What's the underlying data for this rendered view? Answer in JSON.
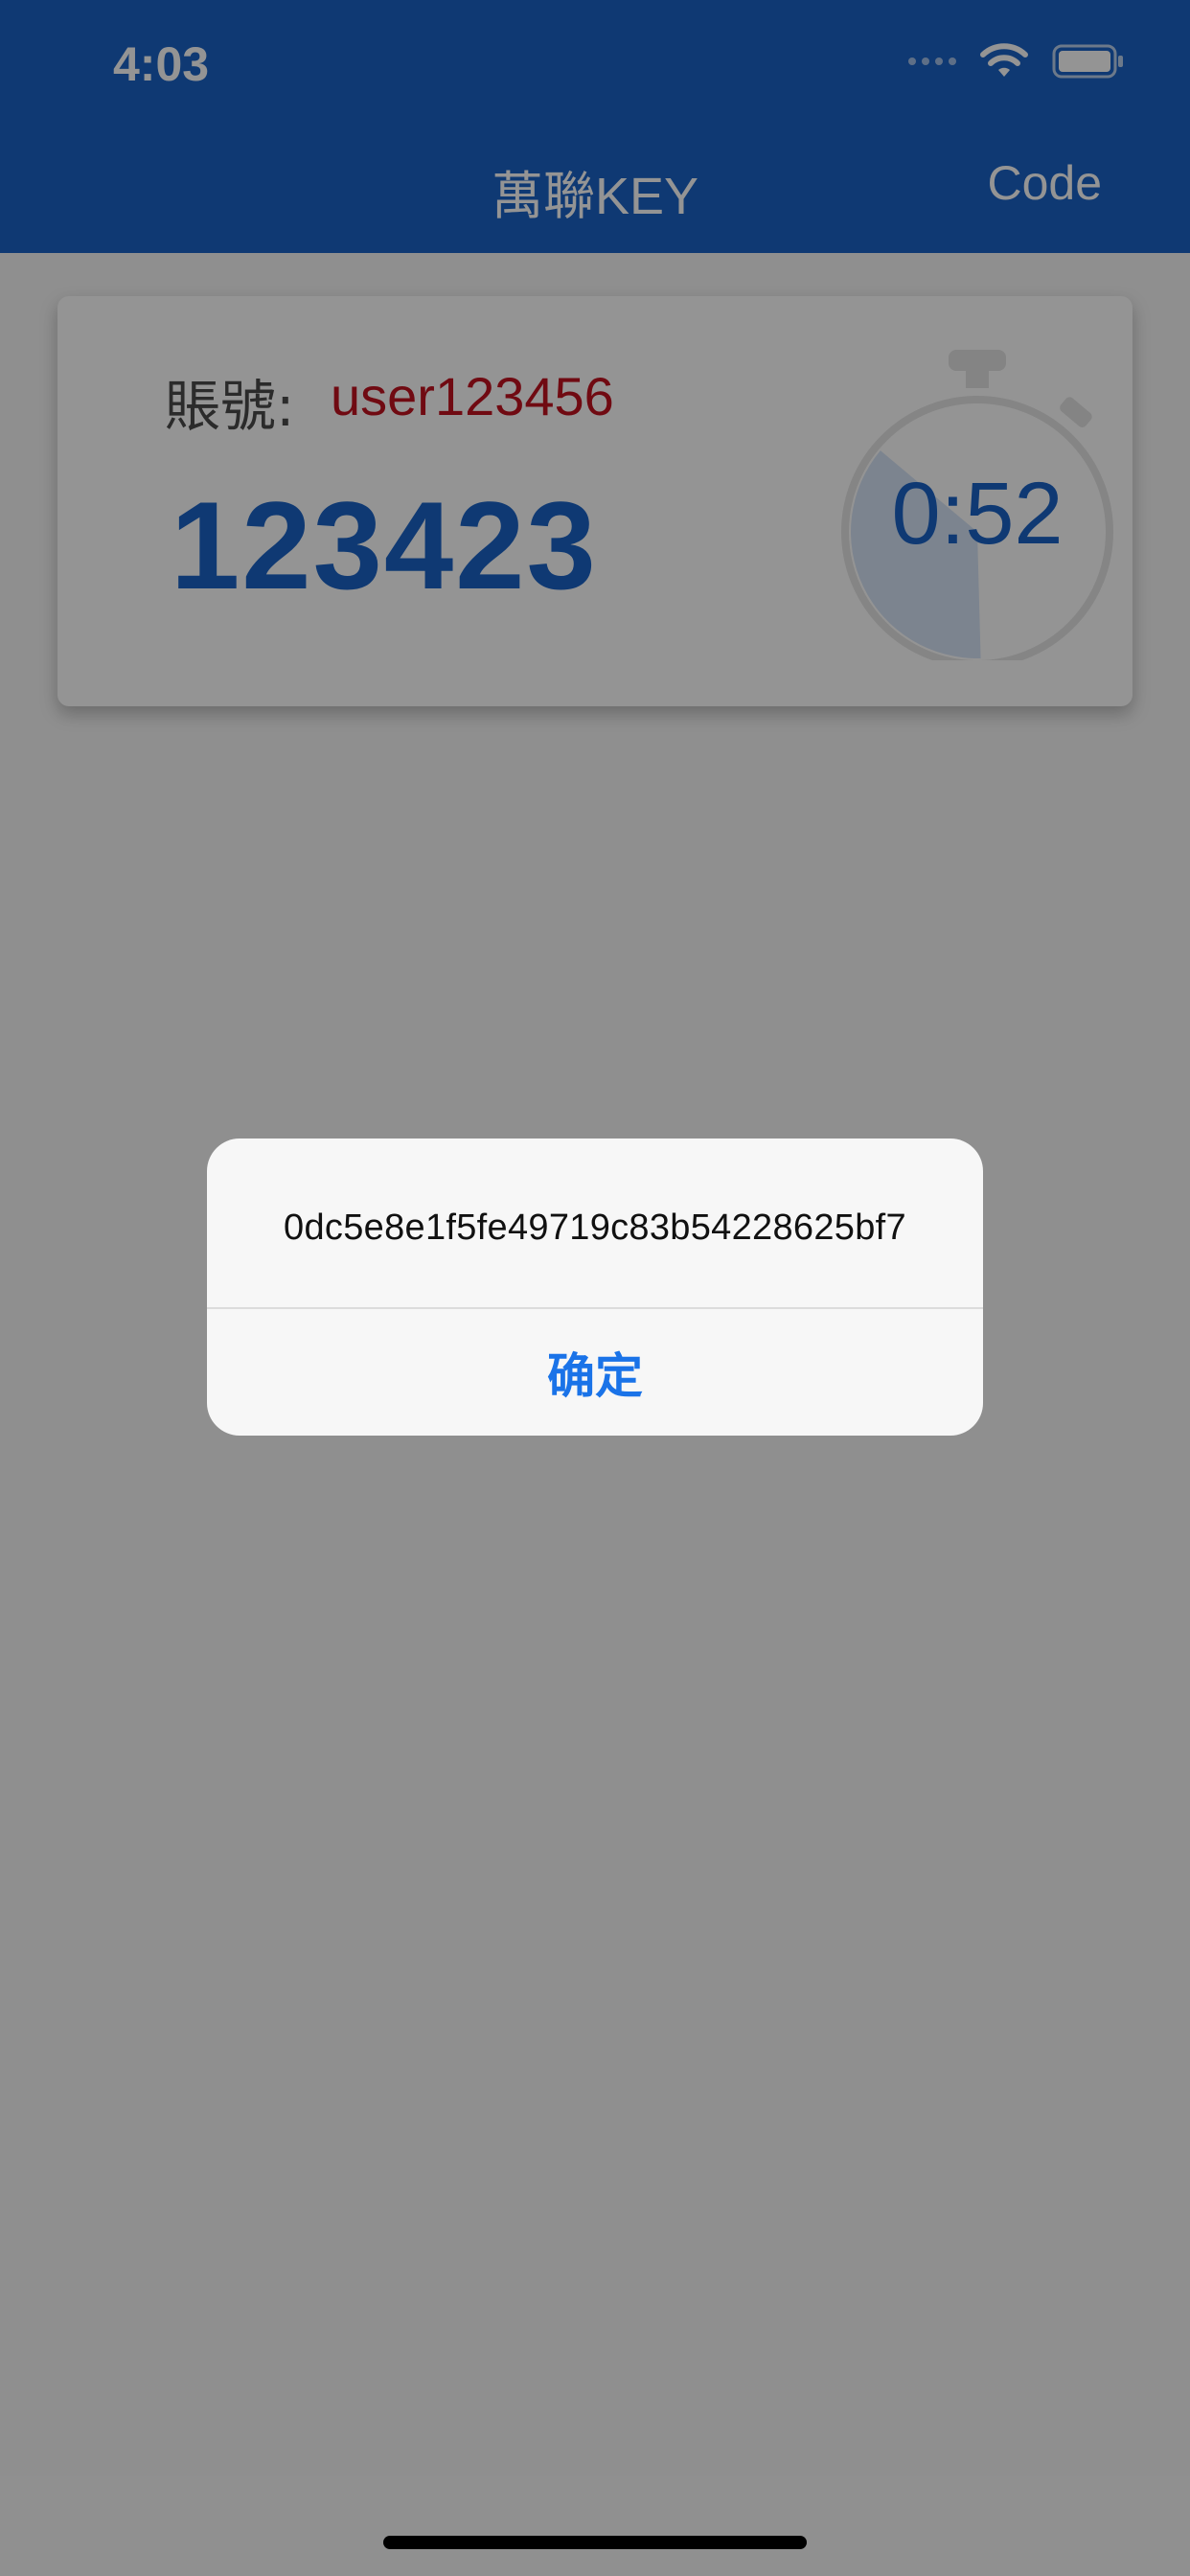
{
  "status_bar": {
    "time": "4:03"
  },
  "navbar": {
    "title": "萬聯KEY",
    "right_button": "Code"
  },
  "card": {
    "account_label": "賬號:",
    "account_value": "user123456",
    "otp_code": "123423",
    "timer_text": "0:52",
    "timer_remaining_fraction": 0.87
  },
  "alert": {
    "message": "0dc5e8e1f5fe49719c83b54228625bf7",
    "confirm_label": "确定"
  },
  "colors": {
    "nav_blue": "#1a63c6",
    "account_red": "#c1121f",
    "alert_button_blue": "#1a73e8"
  },
  "icons": {
    "wifi": "wifi-icon",
    "battery": "battery-icon",
    "stopwatch": "stopwatch-icon"
  }
}
